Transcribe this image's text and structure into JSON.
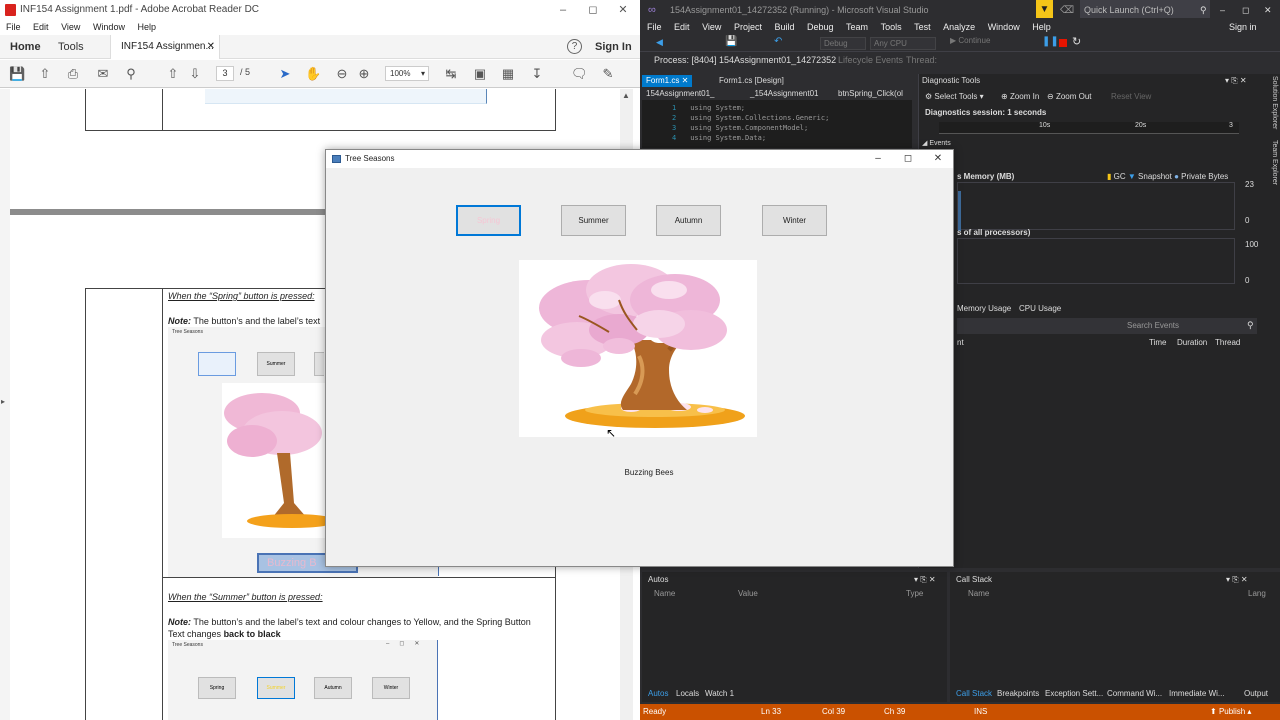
{
  "acrobat": {
    "title": "INF154 Assignment 1.pdf - Adobe Acrobat Reader DC",
    "menu": [
      "File",
      "Edit",
      "View",
      "Window",
      "Help"
    ],
    "nav": {
      "home": "Home",
      "tools": "Tools",
      "tab": "INF154 Assignmen...",
      "sign_in": "Sign In"
    },
    "page_current": "3",
    "page_total": "/ 5",
    "zoom": "100%",
    "doc": {
      "spring_heading": "When the “Spring” button is pressed:",
      "spring_note_label": "Note:",
      "spring_note": "The button’s and the label’s text",
      "thumb_title": "Tree Seasons",
      "thumb_summer": "Summer",
      "thumb_label": "Buzzing B",
      "summer_heading": "When the “Summer” button is pressed:",
      "summer_note_label": "Note:",
      "summer_note": "The button’s and the label’s text and colour changes to Yellow, and the Spring Button",
      "summer_note2": "Text changes",
      "summer_note2_bold": "back to black",
      "thumb2_title": "Tree Seasons",
      "thumb2_buttons": [
        "Spring",
        "Summer",
        "Autumn",
        "Winter"
      ]
    }
  },
  "vs": {
    "title": "154Assignment01_14272352 (Running) - Microsoft Visual Studio",
    "quick_launch": "Quick Launch (Ctrl+Q)",
    "sign_in": "Sign in",
    "menu": [
      "File",
      "Edit",
      "View",
      "Project",
      "Build",
      "Debug",
      "Team",
      "Tools",
      "Test",
      "Analyze",
      "Window",
      "Help"
    ],
    "toolbar": {
      "debug": "Debug",
      "cpu": "Any CPU",
      "continue": "Continue"
    },
    "process": "Process:  [8404] 154Assignment01_14272352",
    "lifecycle": "Lifecycle Events",
    "thread": "Thread:",
    "tabs": [
      "Form1.cs",
      "Form1.cs [Design]"
    ],
    "nav_dropdowns": [
      "154Assignment01_",
      "_154Assignment01",
      "btnSpring_Click(ol"
    ],
    "code_lines": [
      {
        "n": "1",
        "t": "using System;"
      },
      {
        "n": "2",
        "t": "using System.Collections.Generic;"
      },
      {
        "n": "3",
        "t": "using System.ComponentModel;"
      },
      {
        "n": "4",
        "t": "using System.Data;"
      }
    ],
    "diag": {
      "title": "Diagnostic Tools",
      "select_tools": "Select Tools",
      "zoom_in": "Zoom In",
      "zoom_out": "Zoom Out",
      "reset_view": "Reset View",
      "session": "Diagnostics session: 1 seconds",
      "tick1": "10s",
      "tick2": "20s",
      "tick3": "3",
      "events": "Events",
      "memory": "s Memory (MB)",
      "gc": "GC",
      "snapshot": "Snapshot",
      "private_bytes": "Private Bytes",
      "mem_max": "23",
      "mem_min": "0",
      "cpu": "s of all processors)",
      "cpu_max": "100",
      "cpu_min": "0",
      "tabs": [
        "Memory Usage",
        "CPU Usage"
      ],
      "search": "Search Events",
      "cols": [
        "nt",
        "Time",
        "Duration",
        "Thread"
      ]
    },
    "autos": {
      "title": "Autos",
      "cols": [
        "Name",
        "Value",
        "Type"
      ],
      "tabs": [
        "Autos",
        "Locals",
        "Watch 1"
      ]
    },
    "callstack": {
      "title": "Call Stack",
      "cols": [
        "Name",
        "Lang"
      ],
      "tabs": [
        "Call Stack",
        "Breakpoints",
        "Exception Sett...",
        "Command Wi...",
        "Immediate Wi...",
        "Output"
      ]
    },
    "side": [
      "Solution Explorer",
      "Team Explorer"
    ],
    "status": {
      "ready": "Ready",
      "ln": "Ln 33",
      "col": "Col 39",
      "ch": "Ch 39",
      "ins": "INS",
      "publish": "Publish"
    }
  },
  "app": {
    "title": "Tree Seasons",
    "buttons": [
      "Spring",
      "Summer",
      "Autumn",
      "Winter"
    ],
    "label": "Buzzing Bees",
    "colors": {
      "spring_text": "#f5c6d4",
      "selected_border": "#0078d7"
    }
  }
}
